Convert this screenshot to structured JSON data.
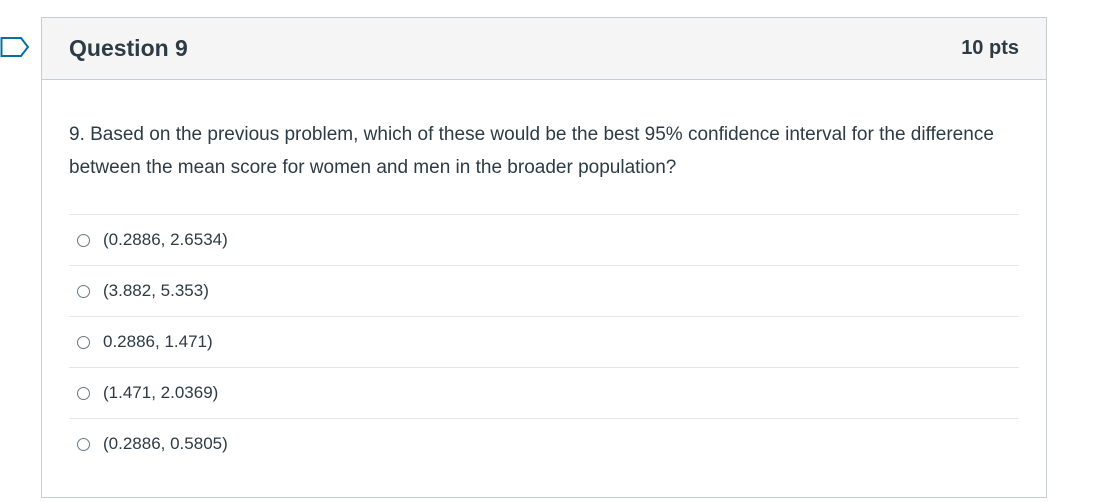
{
  "question": {
    "title": "Question 9",
    "points": "10 pts",
    "text": "9. Based on the previous problem, which of these would be the best 95% confidence interval for the difference between the mean score for women and men in the broader population?",
    "answers": [
      {
        "label": "(0.2886, 2.6534)"
      },
      {
        "label": "(3.882, 5.353)"
      },
      {
        "label": "0.2886, 1.471)"
      },
      {
        "label": "(1.471, 2.0369)"
      },
      {
        "label": "(0.2886, 0.5805)"
      }
    ]
  },
  "colors": {
    "text": "#2d3b45",
    "header_bg": "#f5f5f5",
    "border": "#c7cdd1",
    "flag": "#0770a3"
  },
  "icons": {
    "flag": "bookmark-flag-icon",
    "radio": "radio-empty-icon"
  }
}
